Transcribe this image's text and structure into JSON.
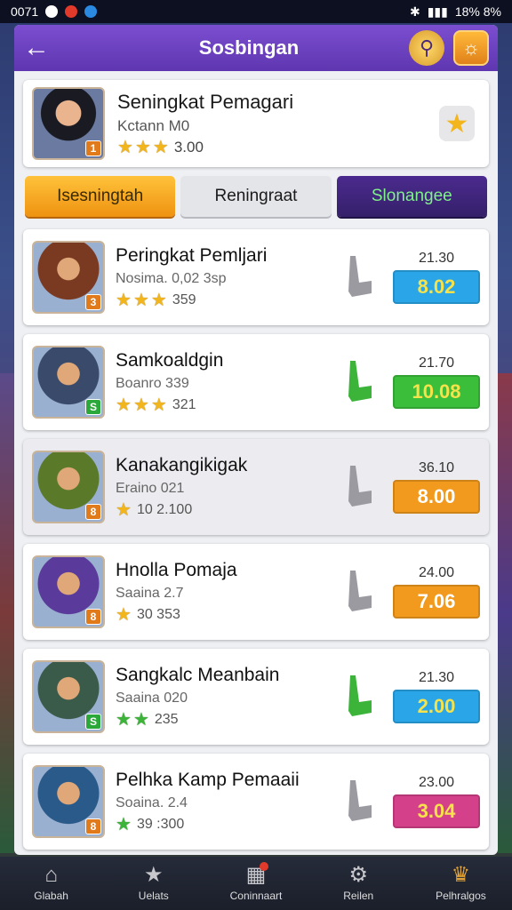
{
  "status_bar": {
    "time": "0071",
    "right": "18% 8%"
  },
  "header": {
    "title": "Sosbingan"
  },
  "profile": {
    "name": "Seningkat Pemagari",
    "subtitle": "Kctann M0",
    "rating": "3.00",
    "stars": 3,
    "level": "1"
  },
  "tabs": [
    {
      "label": "Isesningtah"
    },
    {
      "label": "Reningraat"
    },
    {
      "label": "Slonangee"
    }
  ],
  "rows": [
    {
      "name": "Peringkat Pemljari",
      "sub": "Nosima. 0,02 3sp",
      "stars": 3,
      "star_color": "gold",
      "rating_text": "359",
      "level": "3",
      "top_value": "21.30",
      "score": "8.02",
      "score_bg": "#2aa6e8",
      "score_fg": "#f6e24a",
      "trend": "down",
      "trend_color": "#9a9aa0",
      "avatar_bg": "#7a3a22"
    },
    {
      "name": "Samkoaldgin",
      "sub": "Boanro 339",
      "stars": 3,
      "star_color": "gold",
      "rating_text": "321",
      "level": "S",
      "top_value": "21.70",
      "score": "10.08",
      "score_bg": "#3bbf3b",
      "score_fg": "#f6e24a",
      "trend": "up",
      "trend_color": "#3cb43a",
      "avatar_bg": "#3a4a6a"
    },
    {
      "name": "Kanakangikigak",
      "sub": "Eraino 021",
      "stars": 1,
      "star_color": "gold",
      "rating_text": "10 2.100",
      "level": "8",
      "top_value": "36.10",
      "score": "8.00",
      "score_bg": "#f29a1e",
      "score_fg": "#ffffff",
      "trend": "down",
      "trend_color": "#9a9aa0",
      "avatar_bg": "#5a7a2a"
    },
    {
      "name": "Hnolla Pomaja",
      "sub": "Saaina 2.7",
      "stars": 1,
      "star_color": "gold",
      "rating_text": "30 353",
      "level": "8",
      "top_value": "24.00",
      "score": "7.06",
      "score_bg": "#f29a1e",
      "score_fg": "#ffffff",
      "trend": "down",
      "trend_color": "#9a9aa0",
      "avatar_bg": "#5a3a9a"
    },
    {
      "name": "Sangkalc Meanbain",
      "sub": "Saaina 020",
      "stars": 2,
      "star_color": "green",
      "rating_text": "235",
      "level": "S",
      "top_value": "21.30",
      "score": "2.00",
      "score_bg": "#2aa6e8",
      "score_fg": "#f6e24a",
      "trend": "up",
      "trend_color": "#3cb43a",
      "avatar_bg": "#3a5a4a"
    },
    {
      "name": "Pelhka Kamp Pemaaii",
      "sub": "Soaina. 2.4",
      "stars": 1,
      "star_color": "green",
      "rating_text": "39 :300",
      "level": "8",
      "top_value": "23.00",
      "score": "3.04",
      "score_bg": "#d4408a",
      "score_fg": "#f6e24a",
      "trend": "down",
      "trend_color": "#9a9aa0",
      "avatar_bg": "#2a5a8a"
    }
  ],
  "nav": [
    {
      "label": "Glabah",
      "icon": "home-icon"
    },
    {
      "label": "Uelats",
      "icon": "star-icon"
    },
    {
      "label": "Coninnaart",
      "icon": "building-icon"
    },
    {
      "label": "Reilen",
      "icon": "gear-icon"
    },
    {
      "label": "Pelhralgos",
      "icon": "trophy-icon"
    }
  ],
  "colors": {
    "header": "#6a3fc0",
    "tab_active": "#f5a623",
    "tab_alt": "#3d2480"
  }
}
